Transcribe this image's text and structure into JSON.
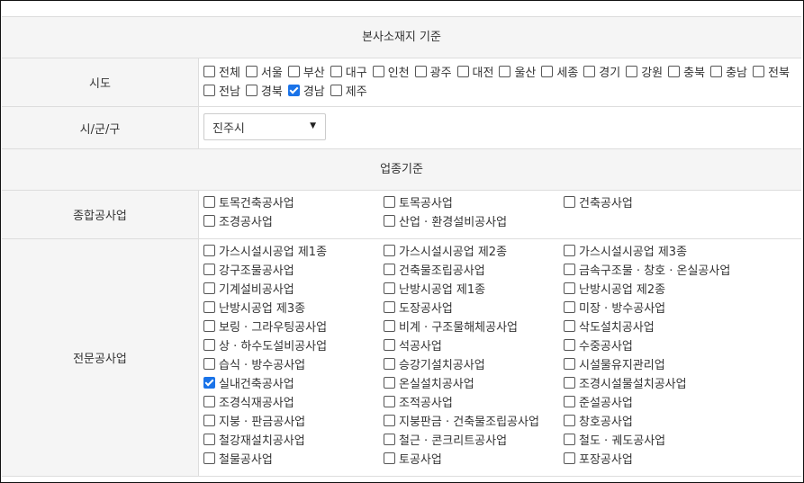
{
  "sections": {
    "hq_title": "본사소재지 기준",
    "biz_title": "업종기준"
  },
  "sido": {
    "label": "시도",
    "options": [
      {
        "label": "전체",
        "checked": false
      },
      {
        "label": "서울",
        "checked": false
      },
      {
        "label": "부산",
        "checked": false
      },
      {
        "label": "대구",
        "checked": false
      },
      {
        "label": "인천",
        "checked": false
      },
      {
        "label": "광주",
        "checked": false
      },
      {
        "label": "대전",
        "checked": false
      },
      {
        "label": "울산",
        "checked": false
      },
      {
        "label": "세종",
        "checked": false
      },
      {
        "label": "경기",
        "checked": false
      },
      {
        "label": "강원",
        "checked": false
      },
      {
        "label": "충북",
        "checked": false
      },
      {
        "label": "충남",
        "checked": false
      },
      {
        "label": "전북",
        "checked": false
      },
      {
        "label": "전남",
        "checked": false
      },
      {
        "label": "경북",
        "checked": false
      },
      {
        "label": "경남",
        "checked": true
      },
      {
        "label": "제주",
        "checked": false
      }
    ]
  },
  "sigungu": {
    "label": "시/군/구",
    "selected": "진주시",
    "caret": "▼"
  },
  "general": {
    "label": "종합공사업",
    "options": [
      {
        "label": "토목건축공사업",
        "checked": false
      },
      {
        "label": "토목공사업",
        "checked": false
      },
      {
        "label": "건축공사업",
        "checked": false
      },
      {
        "label": "조경공사업",
        "checked": false
      },
      {
        "label": "산업 · 환경설비공사업",
        "checked": false
      }
    ]
  },
  "special": {
    "label": "전문공사업",
    "options": [
      {
        "label": "가스시설시공업 제1종",
        "checked": false
      },
      {
        "label": "가스시설시공업 제2종",
        "checked": false
      },
      {
        "label": "가스시설시공업 제3종",
        "checked": false
      },
      {
        "label": "강구조물공사업",
        "checked": false
      },
      {
        "label": "건축물조립공사업",
        "checked": false
      },
      {
        "label": "금속구조물 · 창호 · 온실공사업",
        "checked": false
      },
      {
        "label": "기계설비공사업",
        "checked": false
      },
      {
        "label": "난방시공업 제1종",
        "checked": false
      },
      {
        "label": "난방시공업 제2종",
        "checked": false
      },
      {
        "label": "난방시공업 제3종",
        "checked": false
      },
      {
        "label": "도장공사업",
        "checked": false
      },
      {
        "label": "미장 · 방수공사업",
        "checked": false
      },
      {
        "label": "보링 · 그라우팅공사업",
        "checked": false
      },
      {
        "label": "비계 · 구조물해체공사업",
        "checked": false
      },
      {
        "label": "삭도설치공사업",
        "checked": false
      },
      {
        "label": "상 · 하수도설비공사업",
        "checked": false
      },
      {
        "label": "석공사업",
        "checked": false
      },
      {
        "label": "수중공사업",
        "checked": false
      },
      {
        "label": "습식 · 방수공사업",
        "checked": false
      },
      {
        "label": "승강기설치공사업",
        "checked": false
      },
      {
        "label": "시설물유지관리업",
        "checked": false
      },
      {
        "label": "실내건축공사업",
        "checked": true
      },
      {
        "label": "온실설치공사업",
        "checked": false
      },
      {
        "label": "조경시설물설치공사업",
        "checked": false
      },
      {
        "label": "조경식재공사업",
        "checked": false
      },
      {
        "label": "조적공사업",
        "checked": false
      },
      {
        "label": "준설공사업",
        "checked": false
      },
      {
        "label": "지붕 · 판금공사업",
        "checked": false
      },
      {
        "label": "지붕판금 · 건축물조립공사업",
        "checked": false
      },
      {
        "label": "창호공사업",
        "checked": false
      },
      {
        "label": "철강재설치공사업",
        "checked": false
      },
      {
        "label": "철근 · 콘크리트공사업",
        "checked": false
      },
      {
        "label": "철도 · 궤도공사업",
        "checked": false
      },
      {
        "label": "철물공사업",
        "checked": false
      },
      {
        "label": "토공사업",
        "checked": false
      },
      {
        "label": "포장공사업",
        "checked": false
      }
    ]
  }
}
